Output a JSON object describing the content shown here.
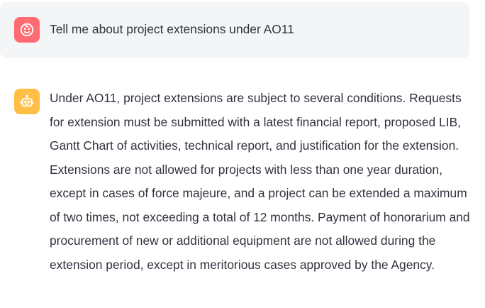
{
  "conversation": {
    "user_message": {
      "avatar_icon": "smiley-face-icon",
      "avatar_color": "#ff6b72",
      "text": "Tell me about project extensions under AO11"
    },
    "assistant_message": {
      "avatar_icon": "robot-icon",
      "avatar_color": "#ffbe45",
      "text": "Under AO11, project extensions are subject to several conditions. Requests for extension must be submitted with a latest financial report, proposed LIB, Gantt Chart of activities, technical report, and justification for the extension. Extensions are not allowed for projects with less than one year duration, except in cases of force majeure, and a project can be extended a maximum of two times, not exceeding a total of 12 months. Payment of honorarium and procurement of new or additional equipment are not allowed during the extension period, except in meritorious cases approved by the Agency."
    }
  }
}
